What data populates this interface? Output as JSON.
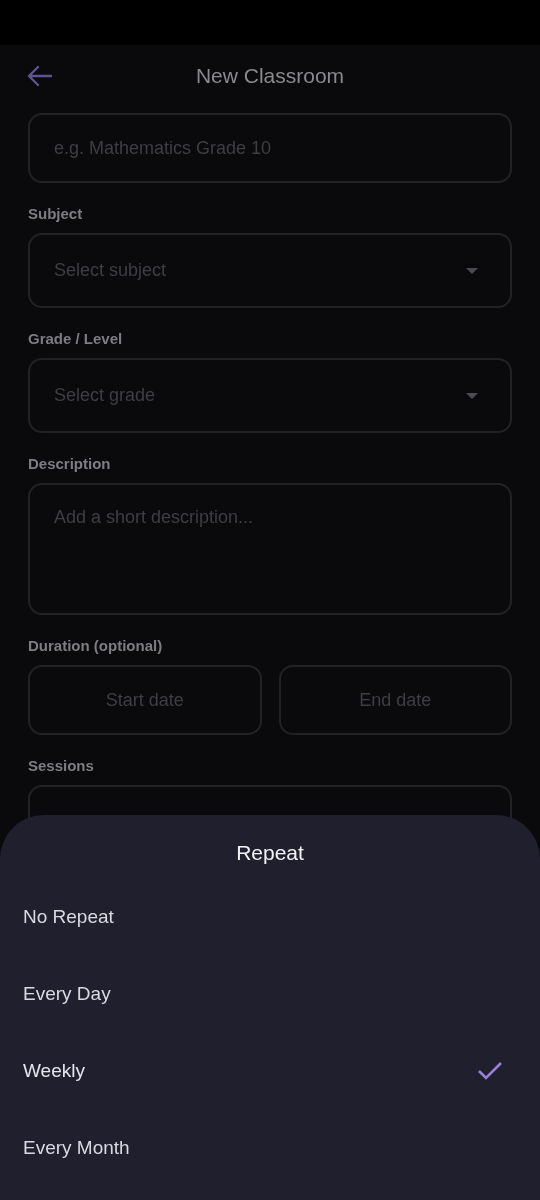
{
  "app_bar": {
    "title": "New Classroom"
  },
  "fields": [
    {
      "kind": "text",
      "placeholder": "e.g. Mathematics Grade 10"
    },
    {
      "kind": "dropdown",
      "label": "Subject",
      "placeholder": "Select subject"
    },
    {
      "kind": "dropdown",
      "label": "Grade / Level",
      "placeholder": "Select grade"
    },
    {
      "kind": "textarea",
      "label": "Description",
      "placeholder": "Add a short description..."
    },
    {
      "kind": "date_range",
      "label": "Duration (optional)",
      "placeholders": [
        "Start date",
        "End date"
      ]
    },
    {
      "kind": "hidden",
      "label": "Sessions"
    }
  ],
  "sheet": {
    "title": "Repeat",
    "options": [
      {
        "label": "No Repeat",
        "selected": false
      },
      {
        "label": "Every Day",
        "selected": false
      },
      {
        "label": "Weekly",
        "selected": true
      },
      {
        "label": "Every Month",
        "selected": false
      }
    ]
  }
}
